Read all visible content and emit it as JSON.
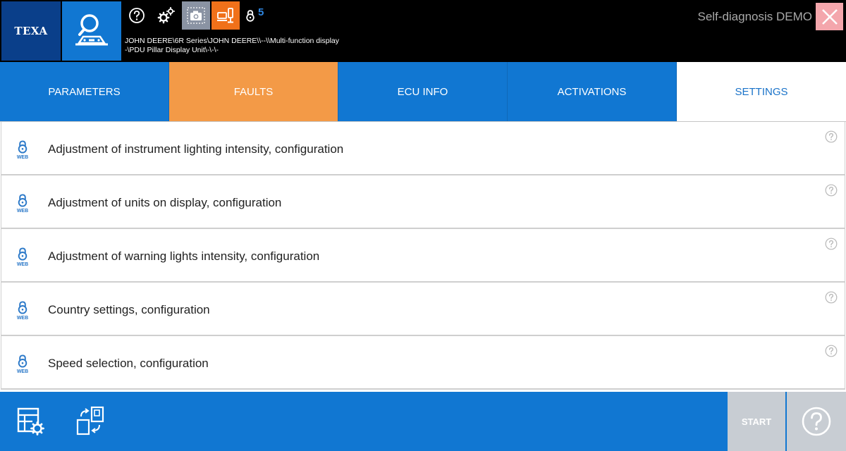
{
  "header": {
    "logo_text": "TEXA",
    "web_lock_count": "5",
    "vehicle_path_line1": "JOHN DEERE\\6R Series\\JOHN DEERE\\\\--\\\\Multi-function display",
    "vehicle_path_line2": "-\\PDU Pillar Display Unit\\-\\-\\-",
    "mode_label": "Self-diagnosis DEMO",
    "icons": {
      "diagnosis": "vehicle-search-icon",
      "help": "question-circle-icon",
      "settings": "gears-icon",
      "screenshot": "camera-icon",
      "connection": "device-connection-icon",
      "web": "web-lock-icon",
      "close": "close-icon"
    }
  },
  "tabs": [
    {
      "label": "PARAMETERS"
    },
    {
      "label": "FAULTS"
    },
    {
      "label": "ECU INFO"
    },
    {
      "label": "ACTIVATIONS"
    },
    {
      "label": "SETTINGS"
    }
  ],
  "list": {
    "lock_badge": "WEB",
    "items": [
      {
        "label": "Adjustment of instrument lighting intensity, configuration"
      },
      {
        "label": "Adjustment of units on display, configuration"
      },
      {
        "label": "Adjustment of warning lights intensity, configuration"
      },
      {
        "label": "Country settings, configuration"
      },
      {
        "label": "Speed selection, configuration"
      }
    ]
  },
  "footer": {
    "start_label": "START",
    "icons": {
      "config": "list-settings-icon",
      "transfer": "file-transfer-icon",
      "help": "question-circle-icon"
    }
  },
  "colors": {
    "primary_blue": "#1177d2",
    "texa_blue": "#0a3f8a",
    "faults_orange": "#f39a47",
    "connection_orange": "#f0711a",
    "close_pink": "#f4a6ac",
    "disabled_gray": "#c8cdd3"
  }
}
